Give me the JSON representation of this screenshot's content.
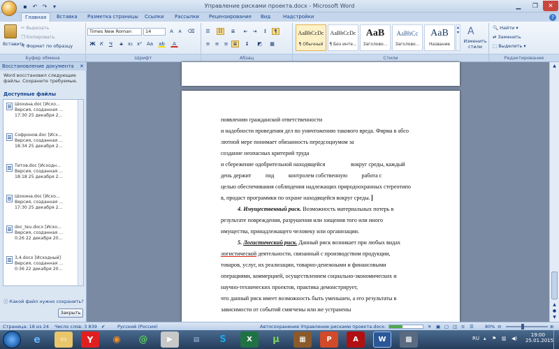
{
  "window": {
    "title": "Управление рисками проекта.docx - Microsoft Word"
  },
  "tabs": [
    "Главная",
    "Вставка",
    "Разметка страницы",
    "Ссылки",
    "Рассылки",
    "Рецензирование",
    "Вид",
    "Надстройки"
  ],
  "clipboard": {
    "paste": "Вставить",
    "cut": "Вырезать",
    "copy": "Копировать",
    "format_painter": "Формат по образцу",
    "group": "Буфер обмена"
  },
  "font": {
    "name": "Times New Roman",
    "size": "14",
    "group": "Шрифт"
  },
  "paragraph": {
    "group": "Абзац"
  },
  "styles": {
    "items": [
      {
        "preview": "AaBbCcDc",
        "name": "¶ Обычный"
      },
      {
        "preview": "AaBbCcDc",
        "name": "¶ Без инте..."
      },
      {
        "preview": "AaB",
        "name": "Заголово..."
      },
      {
        "preview": "AaBbCc",
        "name": "Заголово..."
      },
      {
        "preview": "AaB",
        "name": "Название"
      }
    ],
    "change": "Изменить стили",
    "group": "Стили"
  },
  "editing": {
    "find": "Найти",
    "replace": "Заменить",
    "select": "Выделить",
    "group": "Редактирование"
  },
  "recovery": {
    "header": "Восстановление документа",
    "message": "Word восстановил следующие файлы. Сохраните требуемые.",
    "available": "Доступные файлы",
    "files": [
      {
        "name": "Шохина.doc [Исхо...",
        "desc": "Версия, созданная ...",
        "time": "17:30 25 декабря 2..."
      },
      {
        "name": "Софронов.doc [Исх...",
        "desc": "Версия, созданная ...",
        "time": "18:34 25 декабря 2..."
      },
      {
        "name": "Титов.doc [Исходн...",
        "desc": "Версия, созданная ...",
        "time": "18:18 25 декабря 2..."
      },
      {
        "name": "Шохина.doc [Исхо...",
        "desc": "Версия, созданная ...",
        "time": "17:30 25 декабря 2..."
      },
      {
        "name": "doc_teu.docx [Исхо...",
        "desc": "Версия, созданная ...",
        "time": "0:26 22 декабря 20..."
      },
      {
        "name": "3,4.docx [Исходный]",
        "desc": "Версия, созданная ...",
        "time": "0:36 22 декабря 20..."
      }
    ],
    "question": "Какой файл нужно сохранить?",
    "close": "Закрыть"
  },
  "document": {
    "lines": [
      "появлению гражданской ответственности",
      "и надобности проведения дел по уничтожению такового вреда. Фирма в абсо",
      "лютной мере понимает обязанность передсоцнумом за",
      "создание неопасных критерий труда",
      "и сбережение одобрительной находящейся                  вокруг среды, каждый",
      "день держит          под          контролем собственную          работа с",
      "целью обеспечивания соблюдения надлежащих природоохранных стереотипо",
      "в, продаст программки по охране находящейся вокруг среды."
    ],
    "p4_num": "4.",
    "p4_title": "Имущественный риск.",
    "p4_rest": "Возможность материальных потерь в",
    "p4_lines": [
      "результате повреждения, разрушения или хищения того или иного",
      "имущества, принадлежащего человеку или организации."
    ],
    "p5_num": "5.",
    "p5_title": "Логистический риск.",
    "p5_rest": "Данный риск возникает при любых видах",
    "p5_word": "логистической",
    "p5_word_rest": "деятельности, связанный с производством продукции,",
    "p5_lines": [
      "товаров, услуг, их реализации, товарно-денежными и финансовыми",
      "операциями, коммерцией, осуществлением социально-экономических и",
      "научно-технических проектов, практика демонстрирует,",
      "что данный риск имеет возможность быть уменьшен, а его результаты в",
      "зависимости от событий смягчены или же устранены"
    ]
  },
  "status": {
    "page": "Страница: 18 из 24",
    "words": "Число слов: 3 839",
    "lang": "Русский (Россия)",
    "autosave": "Автосохранение Управление рисками проекта.docx:",
    "zoom": "80%"
  },
  "taskbar": {
    "lang": "RU",
    "time": "19:00",
    "date": "25.01.2015"
  }
}
